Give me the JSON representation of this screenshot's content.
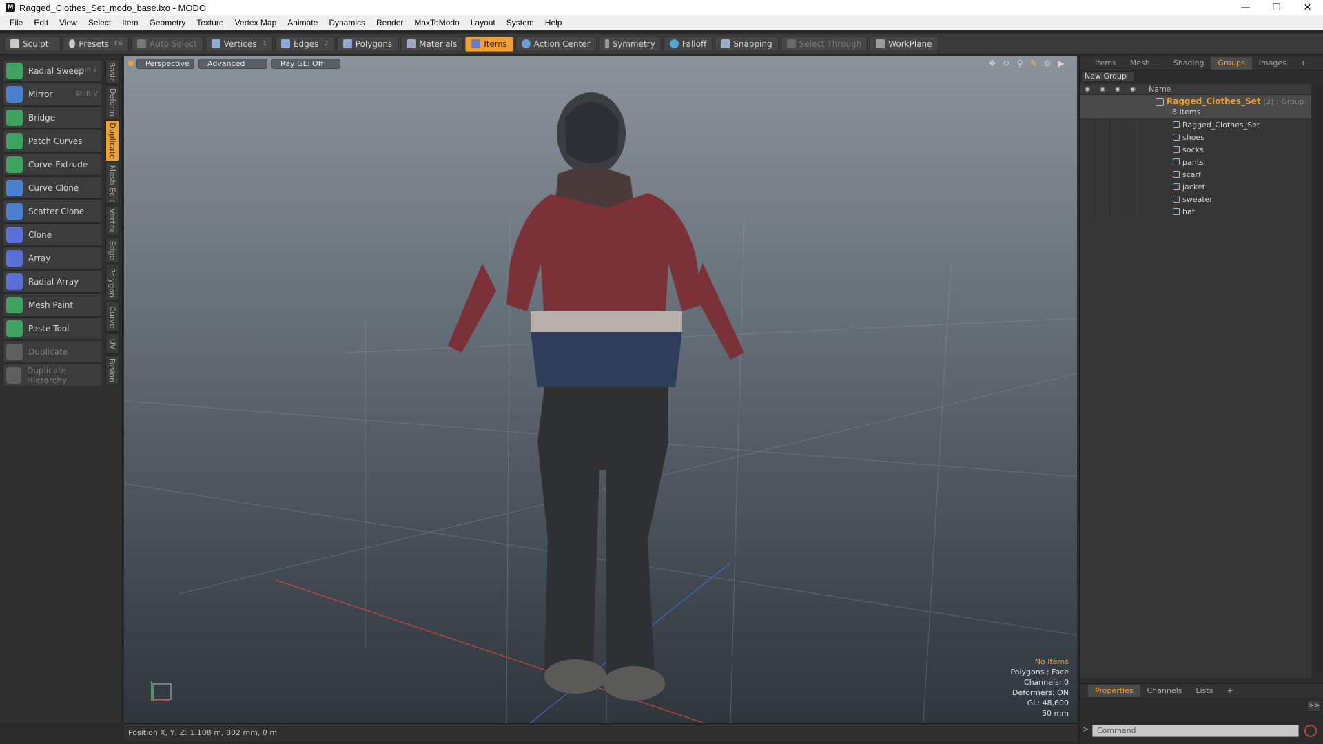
{
  "window": {
    "title": "Ragged_Clothes_Set_modo_base.lxo - MODO",
    "app_icon": "M"
  },
  "menu": [
    "File",
    "Edit",
    "View",
    "Select",
    "Item",
    "Geometry",
    "Texture",
    "Vertex Map",
    "Animate",
    "Dynamics",
    "Render",
    "MaxToModo",
    "Layout",
    "System",
    "Help"
  ],
  "toolbar": {
    "sculpt": "Sculpt",
    "presets": "Presets",
    "presets_key": "F6",
    "auto_select": "Auto Select",
    "vertices": "Vertices",
    "vertices_count": "1",
    "edges": "Edges",
    "edges_count": "2",
    "polygons": "Polygons",
    "materials": "Materials",
    "items": "Items",
    "action_center": "Action Center",
    "symmetry": "Symmetry",
    "falloff": "Falloff",
    "snapping": "Snapping",
    "select_through": "Select Through",
    "workplane": "WorkPlane"
  },
  "tools": [
    {
      "label": "Radial Sweep",
      "key": "Shift-L",
      "color": "#3fa35f"
    },
    {
      "label": "Mirror",
      "key": "Shift-V",
      "color": "#4a7fd0"
    },
    {
      "label": "Bridge",
      "key": "",
      "color": "#3fa35f"
    },
    {
      "label": "Patch Curves",
      "key": "",
      "color": "#3fa35f"
    },
    {
      "label": "Curve Extrude",
      "key": "",
      "color": "#3fa35f"
    },
    {
      "label": "Curve Clone",
      "key": "",
      "color": "#4a7fd0"
    },
    {
      "label": "Scatter Clone",
      "key": "",
      "color": "#4a7fd0"
    },
    {
      "label": "Clone",
      "key": "",
      "color": "#5a6fd8"
    },
    {
      "label": "Array",
      "key": "",
      "color": "#5a6fd8"
    },
    {
      "label": "Radial Array",
      "key": "",
      "color": "#5a6fd8"
    },
    {
      "label": "Mesh Paint",
      "key": "",
      "color": "#3fa35f"
    },
    {
      "label": "Paste Tool",
      "key": "",
      "color": "#3fa35f"
    },
    {
      "label": "Duplicate",
      "key": "",
      "color": "#8a8a8a"
    },
    {
      "label": "Duplicate Hierarchy",
      "key": "",
      "color": "#8a8a8a"
    }
  ],
  "vtabs": [
    "Basic",
    "Deform",
    "Duplicate",
    "Mesh Edit",
    "Vertex",
    "Edge",
    "Polygon",
    "Curve",
    "UV",
    "Fusion"
  ],
  "viewport": {
    "perspective": "Perspective",
    "advanced": "Advanced",
    "raygl": "Ray GL: Off",
    "info": {
      "no_items": "No Items",
      "polygons": "Polygons : Face",
      "channels": "Channels: 0",
      "deformers": "Deformers: ON",
      "gl": "GL: 48,600",
      "focal": "50 mm"
    }
  },
  "status": {
    "position": "Position X, Y, Z:  1.108 m, 802 mm, 0 m"
  },
  "right_panel": {
    "tabs": [
      "Items",
      "Mesh ...",
      "Shading",
      "Groups",
      "Images"
    ],
    "plus": "+",
    "new_group": "New Group",
    "name_header": "Name",
    "group": {
      "name": "Ragged_Clothes_Set",
      "suffix": " (2) : Group",
      "count": "8 Items"
    },
    "items": [
      "Ragged_Clothes_Set",
      "shoes",
      "socks",
      "pants",
      "scarf",
      "jacket",
      "sweater",
      "hat"
    ],
    "bottom_tabs": [
      "Properties",
      "Channels",
      "Lists"
    ],
    "expand": ">>",
    "command_placeholder": "Command",
    "cmd_arrow": ">"
  },
  "colors": {
    "accent": "#f0a030"
  }
}
